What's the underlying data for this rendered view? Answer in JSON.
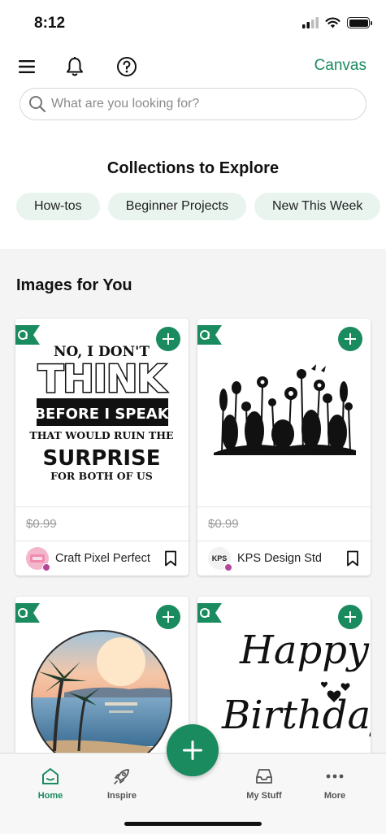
{
  "status_bar": {
    "time": "8:12"
  },
  "header": {
    "menu_icon": "hamburger-menu-icon",
    "bell_icon": "bell-icon",
    "help_icon": "help-icon",
    "canvas_label": "Canvas"
  },
  "search": {
    "placeholder": "What are you looking for?",
    "value": ""
  },
  "collections": {
    "title": "Collections to Explore",
    "chips": [
      "How-tos",
      "Beginner Projects",
      "New This Week"
    ]
  },
  "images_section": {
    "title": "Images for You",
    "cards": [
      {
        "image_lines": [
          "NO, I DON'T",
          "THINK",
          "BEFORE I SPEAK",
          "THAT WOULD RUIN THE",
          "SURPRISE",
          "FOR BOTH OF US"
        ],
        "price": "$0.99",
        "designer": "Craft Pixel Perfect"
      },
      {
        "image_lines": [],
        "price": "$0.99",
        "designer": "KPS Design Std",
        "avatar_text": "KPS"
      },
      {
        "image_lines": [],
        "price": "",
        "designer": ""
      },
      {
        "image_lines": [
          "Happy",
          "Birthday"
        ],
        "price": "",
        "designer": ""
      }
    ]
  },
  "bottom_nav": {
    "items": [
      {
        "label": "Home",
        "icon": "home-icon"
      },
      {
        "label": "Inspire",
        "icon": "rocket-icon"
      },
      {
        "label": "My Stuff",
        "icon": "inbox-icon"
      },
      {
        "label": "More",
        "icon": "more-dots-icon"
      }
    ]
  },
  "colors": {
    "accent": "#1a8a5f",
    "chip_bg": "#e9f4ef",
    "section_bg": "#f4f4f4"
  }
}
